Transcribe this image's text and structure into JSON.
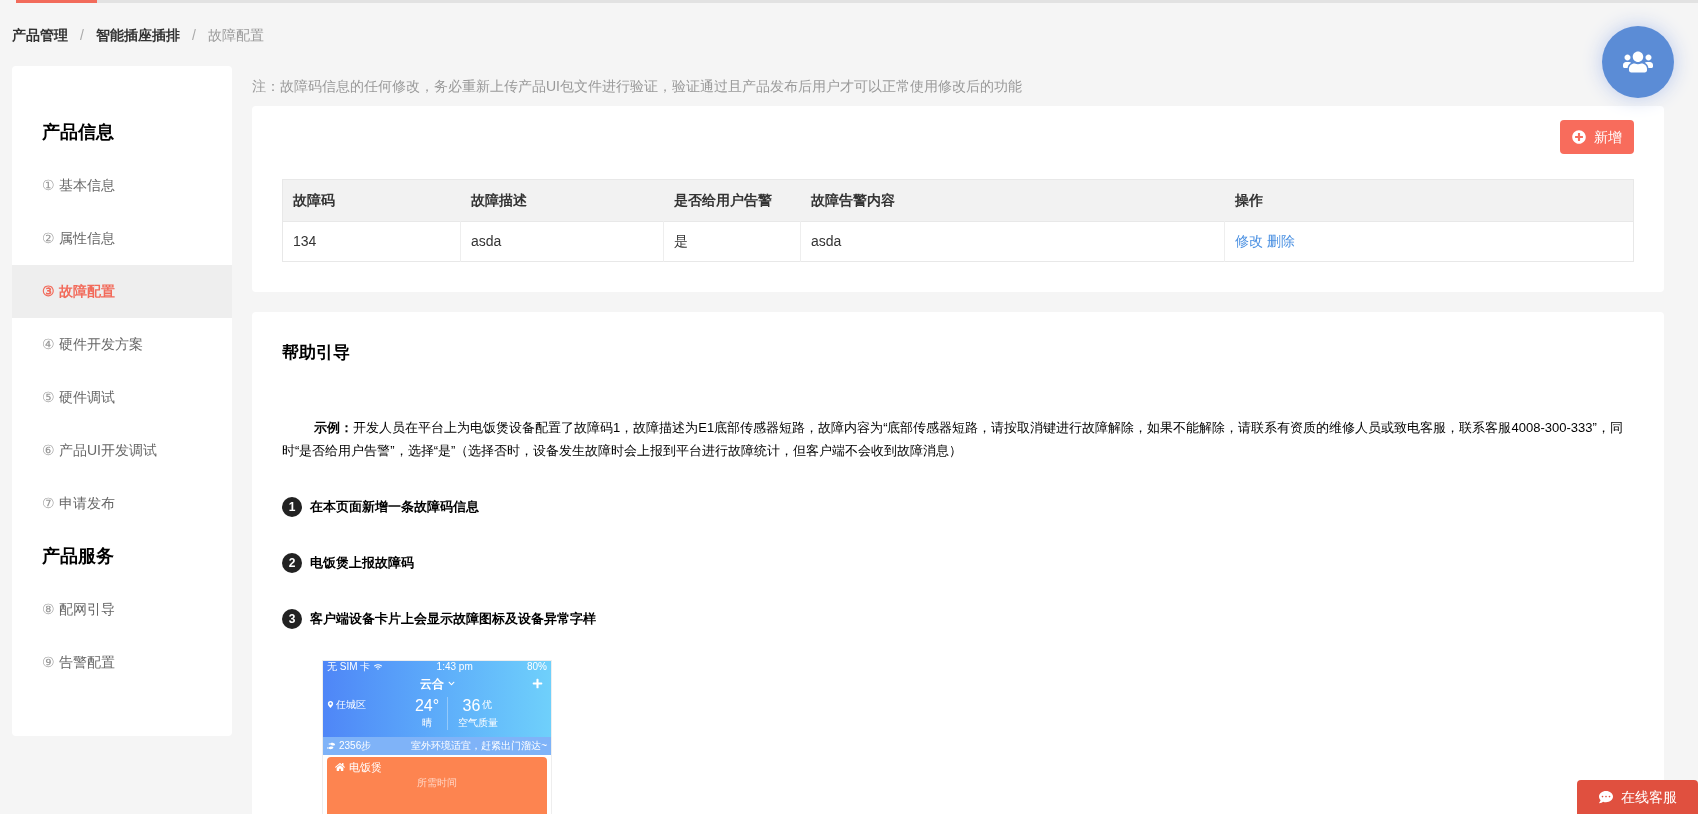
{
  "top_progress": {
    "level": 0.048
  },
  "breadcrumb_separator": "/",
  "breadcrumb": [
    {
      "label": "产品管理",
      "current": false
    },
    {
      "label": "智能插座插排",
      "current": false
    },
    {
      "label": "故障配置",
      "current": true
    }
  ],
  "sidebar": {
    "sections": [
      {
        "title": "产品信息",
        "items": [
          {
            "number": "①",
            "label": "基本信息",
            "selected": false
          },
          {
            "number": "②",
            "label": "属性信息",
            "selected": false
          },
          {
            "number": "③",
            "label": "故障配置",
            "selected": true
          },
          {
            "number": "④",
            "label": "硬件开发方案",
            "selected": false
          },
          {
            "number": "⑤",
            "label": "硬件调试",
            "selected": false
          },
          {
            "number": "⑥",
            "label": "产品UI开发调试",
            "selected": false
          },
          {
            "number": "⑦",
            "label": "申请发布",
            "selected": false
          }
        ]
      },
      {
        "title": "产品服务",
        "items": [
          {
            "number": "⑧",
            "label": "配网引导",
            "selected": false
          },
          {
            "number": "⑨",
            "label": "告警配置",
            "selected": false
          }
        ]
      }
    ]
  },
  "note": "注：故障码信息的任何修改，务必重新上传产品UI包文件进行验证，验证通过且产品发布后用户才可以正常使用修改后的功能",
  "add_button": "新增",
  "table": {
    "columns": [
      "故障码",
      "故障描述",
      "是否给用户告警",
      "故障告警内容",
      "操作"
    ],
    "rows": [
      {
        "cells": [
          "134",
          "asda",
          "是",
          "asda"
        ],
        "actions": [
          "修改",
          "删除"
        ]
      }
    ]
  },
  "help": {
    "title": "帮助引导",
    "example": "**示例：**开发人员在平台上为电饭煲设备配置了故障码1，故障描述为E1底部传感器短路，故障内容为“底部传感器短路，请按取消键进行故障解除，如果不能解除，请联系有资质的维修人员或致电客服，联系客服4008-300-333”，同时“是否给用户告警”，选择“是”（选择否时，设备发生故障时会上报到平台进行故障统计，但客户端不会收到故障消息）",
    "steps": [
      {
        "number": "1",
        "text": "在本页面新增一条故障码信息"
      },
      {
        "number": "2",
        "text": "电饭煲上报故障码"
      },
      {
        "number": "3",
        "text": "客户端设备卡片上会显示故障图标及设备异常字样"
      }
    ],
    "phone": {
      "carrier": "无 SIM 卡",
      "time": "1:43 pm",
      "battery": "80%",
      "home": "云合",
      "location": "任城区",
      "temperature": "24°",
      "weather": "晴",
      "aqi": "36",
      "aqi_level": "优",
      "aqi_label": "空气质量",
      "steps": "2356步",
      "tip": "室外环境适宜，赶紧出门溜达~",
      "device": "电饭煲",
      "device_sub": "所需时间"
    }
  },
  "online_service": "在线客服"
}
